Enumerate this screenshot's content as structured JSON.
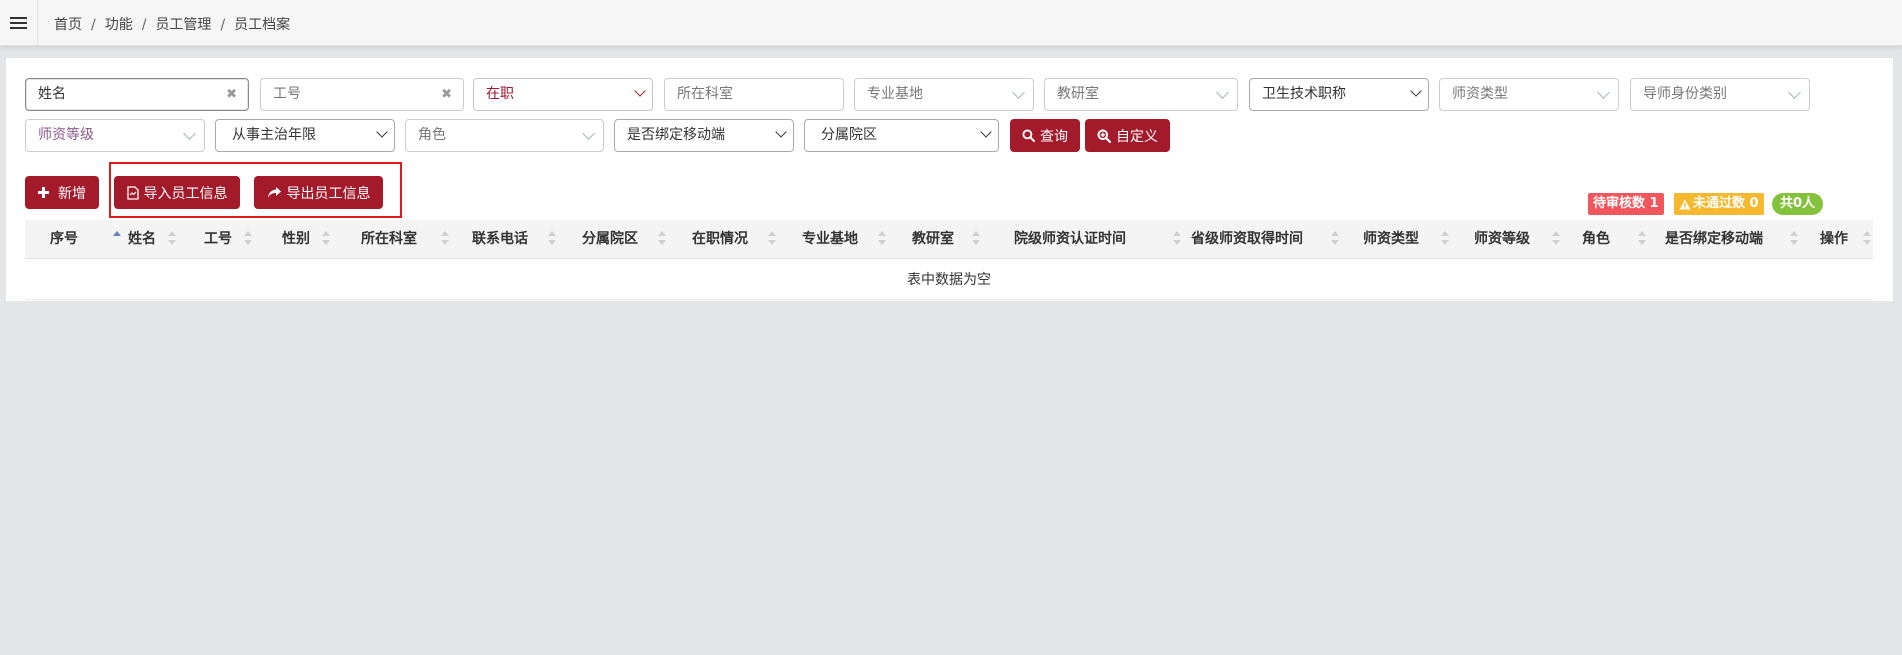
{
  "breadcrumb": [
    "首页",
    "功能",
    "员工管理",
    "员工档案"
  ],
  "filters": {
    "name": "姓名",
    "job_no": "工号",
    "status": "在职",
    "dept": "所在科室",
    "base": "专业基地",
    "teaching_room": "教研室",
    "health_title": "卫生技术职称",
    "teacher_type": "师资类型",
    "mentor_type": "导师身份类别",
    "teacher_level": "师资等级",
    "years": "从事主治年限",
    "role": "角色",
    "mobile_bound": "是否绑定移动端",
    "campus": "分属院区",
    "clear_icon": "✖"
  },
  "buttons": {
    "query": "查询",
    "custom": "自定义",
    "add": "新增",
    "import": "导入员工信息",
    "export": "导出员工信息"
  },
  "badges": {
    "pending": "待审核数 1",
    "failed": "未通过数 0",
    "total": "共0人"
  },
  "table": {
    "columns": [
      "序号",
      "姓名",
      "工号",
      "性别",
      "所在科室",
      "联系电话",
      "分属院区",
      "在职情况",
      "专业基地",
      "教研室",
      "院级师资认证时间",
      "省级师资取得时间",
      "师资类型",
      "师资等级",
      "角色",
      "是否绑定移动端",
      "操作"
    ],
    "empty_text": "表中数据为空"
  },
  "colors": {
    "accent": "#a31a2b",
    "badge_red": "#f0565b",
    "badge_yellow": "#f5b82e",
    "badge_green": "#84c23d",
    "highlight": "#e01b1b"
  }
}
